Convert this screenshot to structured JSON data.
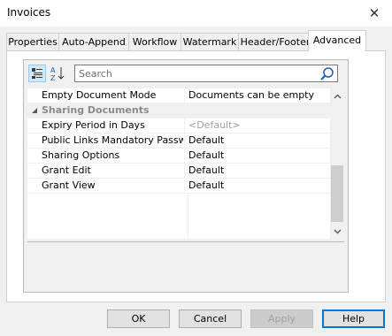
{
  "window": {
    "title": "Invoices",
    "close_glyph": "✕"
  },
  "tabs": [
    {
      "label": "Properties",
      "active": false
    },
    {
      "label": "Auto-Append",
      "active": false
    },
    {
      "label": "Workflow",
      "active": false
    },
    {
      "label": "Watermark",
      "active": false
    },
    {
      "label": "Header/Footer",
      "active": false
    },
    {
      "label": "Advanced",
      "active": true
    }
  ],
  "toolbar": {
    "categorized_icon": "categorized-view-icon",
    "alphabetical_icon": "sort-alphabetical-icon",
    "search_placeholder": "Search",
    "search_value": ""
  },
  "properties": {
    "empty_document_mode": {
      "name": "Empty Document Mode",
      "value": "Documents can be empty"
    },
    "sharing_category": {
      "name": "Sharing Documents",
      "expanded": true
    },
    "expiry_period": {
      "name": "Expiry Period in Days",
      "value": "<Default>"
    },
    "public_links": {
      "name": "Public Links Mandatory Passw...",
      "value": "Default"
    },
    "sharing_options": {
      "name": "Sharing Options",
      "value": "Default"
    },
    "grant_edit": {
      "name": "Grant Edit",
      "value": "Default"
    },
    "grant_view": {
      "name": "Grant View",
      "value": "Default"
    }
  },
  "buttons": {
    "ok": "OK",
    "cancel": "Cancel",
    "apply": "Apply",
    "help": "Help"
  },
  "colors": {
    "accent": "#0078d7",
    "selected_toolbar": "#cde8ff",
    "disabled_text": "#a0a0a0"
  }
}
